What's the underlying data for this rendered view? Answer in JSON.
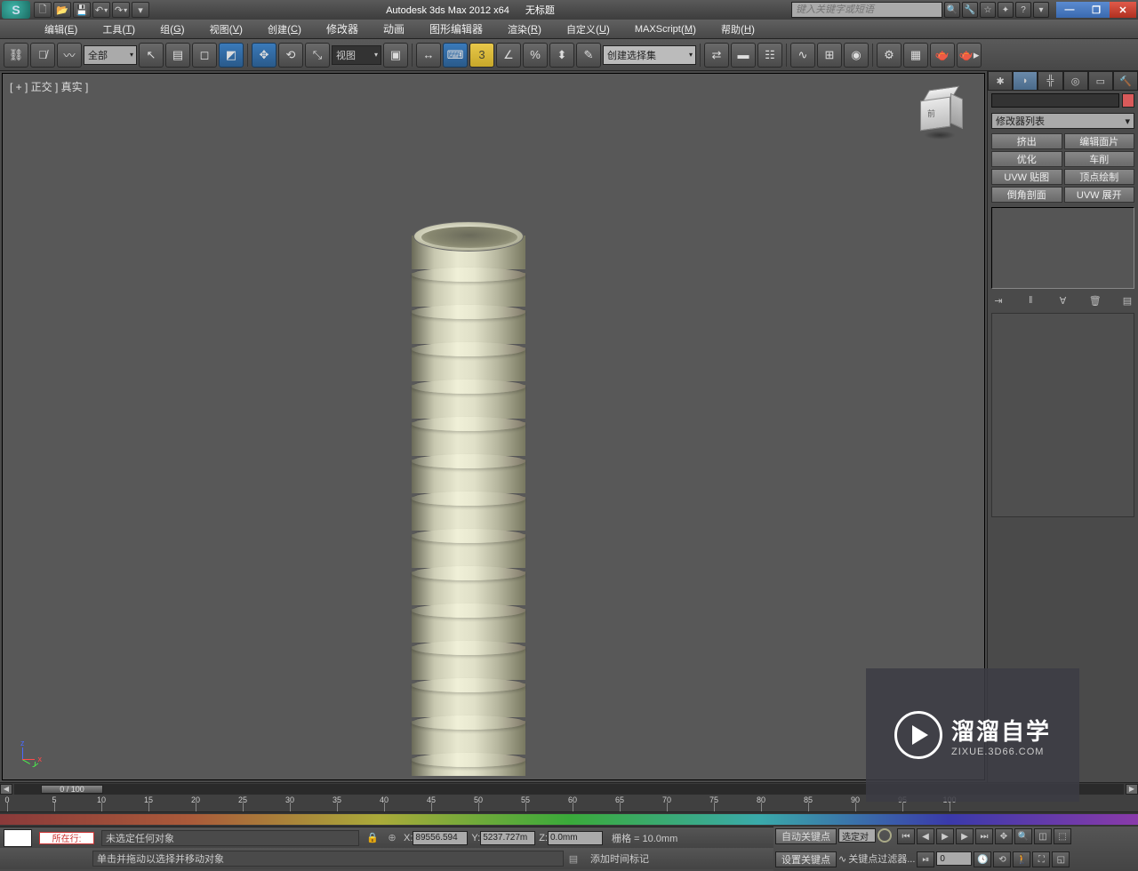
{
  "title": {
    "app": "Autodesk 3ds Max  2012 x64",
    "doc": "无标题"
  },
  "search": {
    "placeholder": "键入关键字或短语"
  },
  "menu": [
    {
      "label": "编辑",
      "key": "E"
    },
    {
      "label": "工具",
      "key": "T"
    },
    {
      "label": "组",
      "key": "G"
    },
    {
      "label": "视图",
      "key": "V"
    },
    {
      "label": "创建",
      "key": "C"
    },
    {
      "label": "修改器",
      "key": ""
    },
    {
      "label": "动画",
      "key": ""
    },
    {
      "label": "图形编辑器",
      "key": ""
    },
    {
      "label": "渲染",
      "key": "R"
    },
    {
      "label": "自定义",
      "key": "U"
    },
    {
      "label": "MAXScript",
      "key": "M"
    },
    {
      "label": "帮助",
      "key": "H"
    }
  ],
  "toolbar": {
    "filter": "全部",
    "viewtype": "视图",
    "selection_set": "创建选择集"
  },
  "viewport": {
    "label": "[ + ] 正交 ] 真实  ]",
    "cube_face": "前"
  },
  "cmdpanel": {
    "mod_list_label": "修改器列表",
    "btns": [
      "挤出",
      "编辑面片",
      "优化",
      "车削",
      "UVW 贴图",
      "顶点绘制",
      "倒角剖面",
      "UVW 展开"
    ]
  },
  "timeline": {
    "slider": "0 / 100",
    "ticks": [
      0,
      5,
      10,
      15,
      20,
      25,
      30,
      35,
      40,
      45,
      50,
      55,
      60,
      65,
      70,
      75,
      80,
      85,
      90,
      95,
      100
    ]
  },
  "status": {
    "current_row": "所在行:",
    "selection": "未选定任何对象",
    "prompt": "单击并拖动以选择并移动对象",
    "x": "89556.594",
    "y": "5237.727m",
    "z": "0.0mm",
    "grid": "栅格 = 10.0mm",
    "add_time_tag": "添加时间标记",
    "auto_key": "自动关键点",
    "set_key": "设置关键点",
    "sel_filter": "选定对",
    "key_filter": "关键点过滤器...",
    "frame": "0"
  },
  "watermark": {
    "line1": "溜溜自学",
    "line2": "ZIXUE.3D66.COM"
  }
}
